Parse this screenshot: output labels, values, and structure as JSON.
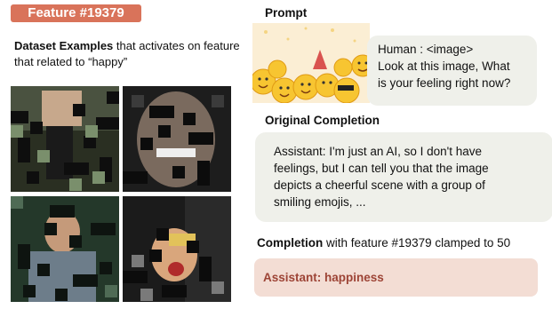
{
  "feature_badge": "Feature #19379",
  "dataset": {
    "caption_bold": "Dataset Examples",
    "caption_rest": " that activates on feature that related to “happy”"
  },
  "prompt": {
    "title": "Prompt",
    "lines": [
      "Human : <image>",
      "Look at this image, What",
      "is your feeling right now?"
    ]
  },
  "original": {
    "title": "Original Completion",
    "lines": [
      "Assistant: I'm just an AI, so I don't have",
      "feelings, but I can tell you that the image",
      "depicts a cheerful scene with a group of",
      "smiling emojis, ..."
    ]
  },
  "clamped": {
    "title_bold": "Completion",
    "title_rest": " with feature #19379 clamped to 50",
    "text": "Assistant: happiness"
  },
  "colors": {
    "badge": "#d9735a",
    "bubble_grey": "#eff0ea",
    "bubble_red": "#f3ddd4",
    "clamp_text": "#9d4436"
  }
}
